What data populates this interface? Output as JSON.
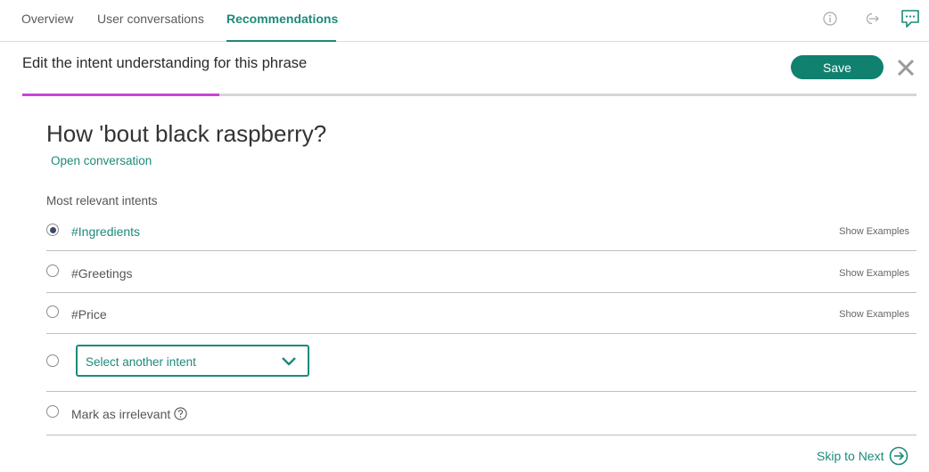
{
  "nav": {
    "tabs": [
      {
        "label": "Overview",
        "active": false
      },
      {
        "label": "User conversations",
        "active": false
      },
      {
        "label": "Recommendations",
        "active": true
      }
    ],
    "icons": [
      "info-icon",
      "exit-icon",
      "chat-icon"
    ]
  },
  "header": {
    "title": "Edit the intent understanding for this phrase",
    "save_label": "Save"
  },
  "progress": {
    "fraction": 0.22,
    "fill_color": "#c944d6"
  },
  "phrase": {
    "text": "How 'bout black raspberry?",
    "open_conversation": "Open conversation"
  },
  "intents": {
    "section_label": "Most relevant intents",
    "options": [
      {
        "label": "#Ingredients",
        "selected": true,
        "show_examples": "Show Examples"
      },
      {
        "label": "#Greetings",
        "selected": false,
        "show_examples": "Show Examples"
      },
      {
        "label": "#Price",
        "selected": false,
        "show_examples": "Show Examples"
      }
    ],
    "select_placeholder": "Select another intent",
    "irrelevant_label": "Mark as irrelevant"
  },
  "footer": {
    "skip_label": "Skip to Next"
  },
  "colors": {
    "accent": "#1d8a7a",
    "save_button": "#10806f",
    "progress": "#c944d6"
  }
}
